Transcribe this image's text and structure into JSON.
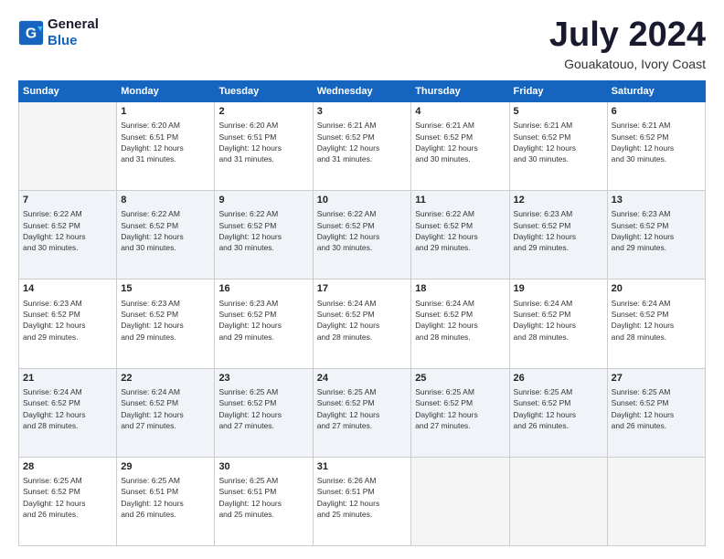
{
  "header": {
    "logo_line1": "General",
    "logo_line2": "Blue",
    "month_title": "July 2024",
    "location": "Gouakatouo, Ivory Coast"
  },
  "days_of_week": [
    "Sunday",
    "Monday",
    "Tuesday",
    "Wednesday",
    "Thursday",
    "Friday",
    "Saturday"
  ],
  "weeks": [
    [
      {
        "day": "",
        "info": ""
      },
      {
        "day": "1",
        "info": "Sunrise: 6:20 AM\nSunset: 6:51 PM\nDaylight: 12 hours\nand 31 minutes."
      },
      {
        "day": "2",
        "info": "Sunrise: 6:20 AM\nSunset: 6:51 PM\nDaylight: 12 hours\nand 31 minutes."
      },
      {
        "day": "3",
        "info": "Sunrise: 6:21 AM\nSunset: 6:52 PM\nDaylight: 12 hours\nand 31 minutes."
      },
      {
        "day": "4",
        "info": "Sunrise: 6:21 AM\nSunset: 6:52 PM\nDaylight: 12 hours\nand 30 minutes."
      },
      {
        "day": "5",
        "info": "Sunrise: 6:21 AM\nSunset: 6:52 PM\nDaylight: 12 hours\nand 30 minutes."
      },
      {
        "day": "6",
        "info": "Sunrise: 6:21 AM\nSunset: 6:52 PM\nDaylight: 12 hours\nand 30 minutes."
      }
    ],
    [
      {
        "day": "7",
        "info": "Sunrise: 6:22 AM\nSunset: 6:52 PM\nDaylight: 12 hours\nand 30 minutes."
      },
      {
        "day": "8",
        "info": "Sunrise: 6:22 AM\nSunset: 6:52 PM\nDaylight: 12 hours\nand 30 minutes."
      },
      {
        "day": "9",
        "info": "Sunrise: 6:22 AM\nSunset: 6:52 PM\nDaylight: 12 hours\nand 30 minutes."
      },
      {
        "day": "10",
        "info": "Sunrise: 6:22 AM\nSunset: 6:52 PM\nDaylight: 12 hours\nand 30 minutes."
      },
      {
        "day": "11",
        "info": "Sunrise: 6:22 AM\nSunset: 6:52 PM\nDaylight: 12 hours\nand 29 minutes."
      },
      {
        "day": "12",
        "info": "Sunrise: 6:23 AM\nSunset: 6:52 PM\nDaylight: 12 hours\nand 29 minutes."
      },
      {
        "day": "13",
        "info": "Sunrise: 6:23 AM\nSunset: 6:52 PM\nDaylight: 12 hours\nand 29 minutes."
      }
    ],
    [
      {
        "day": "14",
        "info": "Sunrise: 6:23 AM\nSunset: 6:52 PM\nDaylight: 12 hours\nand 29 minutes."
      },
      {
        "day": "15",
        "info": "Sunrise: 6:23 AM\nSunset: 6:52 PM\nDaylight: 12 hours\nand 29 minutes."
      },
      {
        "day": "16",
        "info": "Sunrise: 6:23 AM\nSunset: 6:52 PM\nDaylight: 12 hours\nand 29 minutes."
      },
      {
        "day": "17",
        "info": "Sunrise: 6:24 AM\nSunset: 6:52 PM\nDaylight: 12 hours\nand 28 minutes."
      },
      {
        "day": "18",
        "info": "Sunrise: 6:24 AM\nSunset: 6:52 PM\nDaylight: 12 hours\nand 28 minutes."
      },
      {
        "day": "19",
        "info": "Sunrise: 6:24 AM\nSunset: 6:52 PM\nDaylight: 12 hours\nand 28 minutes."
      },
      {
        "day": "20",
        "info": "Sunrise: 6:24 AM\nSunset: 6:52 PM\nDaylight: 12 hours\nand 28 minutes."
      }
    ],
    [
      {
        "day": "21",
        "info": "Sunrise: 6:24 AM\nSunset: 6:52 PM\nDaylight: 12 hours\nand 28 minutes."
      },
      {
        "day": "22",
        "info": "Sunrise: 6:24 AM\nSunset: 6:52 PM\nDaylight: 12 hours\nand 27 minutes."
      },
      {
        "day": "23",
        "info": "Sunrise: 6:25 AM\nSunset: 6:52 PM\nDaylight: 12 hours\nand 27 minutes."
      },
      {
        "day": "24",
        "info": "Sunrise: 6:25 AM\nSunset: 6:52 PM\nDaylight: 12 hours\nand 27 minutes."
      },
      {
        "day": "25",
        "info": "Sunrise: 6:25 AM\nSunset: 6:52 PM\nDaylight: 12 hours\nand 27 minutes."
      },
      {
        "day": "26",
        "info": "Sunrise: 6:25 AM\nSunset: 6:52 PM\nDaylight: 12 hours\nand 26 minutes."
      },
      {
        "day": "27",
        "info": "Sunrise: 6:25 AM\nSunset: 6:52 PM\nDaylight: 12 hours\nand 26 minutes."
      }
    ],
    [
      {
        "day": "28",
        "info": "Sunrise: 6:25 AM\nSunset: 6:52 PM\nDaylight: 12 hours\nand 26 minutes."
      },
      {
        "day": "29",
        "info": "Sunrise: 6:25 AM\nSunset: 6:51 PM\nDaylight: 12 hours\nand 26 minutes."
      },
      {
        "day": "30",
        "info": "Sunrise: 6:25 AM\nSunset: 6:51 PM\nDaylight: 12 hours\nand 25 minutes."
      },
      {
        "day": "31",
        "info": "Sunrise: 6:26 AM\nSunset: 6:51 PM\nDaylight: 12 hours\nand 25 minutes."
      },
      {
        "day": "",
        "info": ""
      },
      {
        "day": "",
        "info": ""
      },
      {
        "day": "",
        "info": ""
      }
    ]
  ]
}
